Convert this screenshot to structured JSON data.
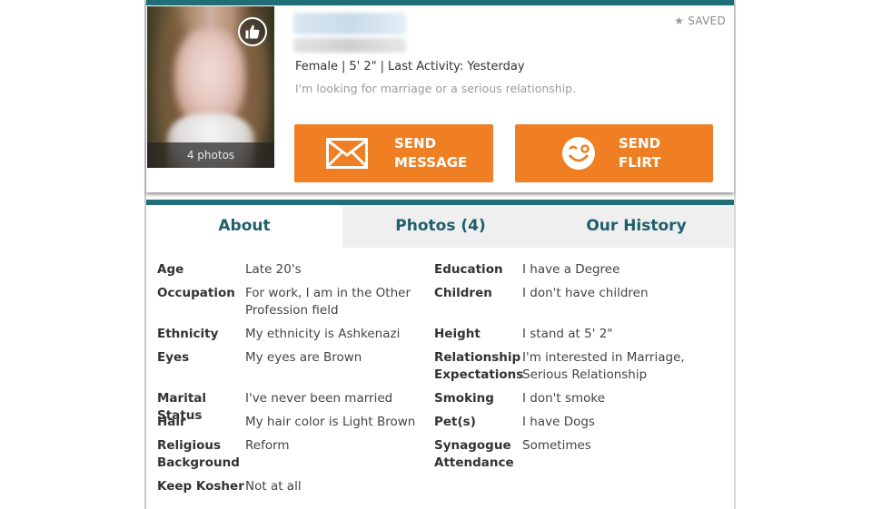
{
  "profile": {
    "saved_label": "SAVED",
    "summary": {
      "gender": "Female",
      "height": "5' 2\"",
      "last_activity": "Last Activity: Yesterday"
    },
    "looking_for": "I'm looking for marriage or a serious relationship.",
    "photo_count": "4 photos",
    "icons": {
      "like": "thumbs-up-icon",
      "saved": "star-icon",
      "message": "envelope-icon",
      "flirt": "wink-face-icon"
    }
  },
  "actions": {
    "message": {
      "line1": "SEND",
      "line2": "MESSAGE"
    },
    "flirt": {
      "line1": "SEND",
      "line2": "FLIRT"
    },
    "color": "#ef7f22"
  },
  "tabs": [
    {
      "label": "About",
      "active": true
    },
    {
      "label": "Photos (4)",
      "active": false
    },
    {
      "label": "Our History",
      "active": false
    }
  ],
  "accent_color": "#1f6e78",
  "details_left": [
    {
      "key": "Age",
      "value": "Late 20's"
    },
    {
      "key": "Occupation",
      "value": "For work, I am in the Other Profession field"
    },
    {
      "key": "Ethnicity",
      "value": "My ethnicity is Ashkenazi"
    },
    {
      "key": "Eyes",
      "value": "My eyes are Brown"
    },
    {
      "key": "Marital Status",
      "value": "I've never been married"
    },
    {
      "key": "Hair",
      "value": "My hair color is Light Brown"
    },
    {
      "key": "Religious Background",
      "value": "Reform"
    },
    {
      "key": "Keep Kosher",
      "value": "Not at all"
    }
  ],
  "details_right": [
    {
      "key": "Education",
      "value": "I have a Degree"
    },
    {
      "key": "Children",
      "value": "I don't have children"
    },
    {
      "key": "Height",
      "value": "I stand at 5' 2\""
    },
    {
      "key": "Relationship Expectations",
      "value": "I'm interested in Marriage, Serious Relationship"
    },
    {
      "key": "Smoking",
      "value": "I don't smoke"
    },
    {
      "key": "Pet(s)",
      "value": "I have Dogs"
    },
    {
      "key": "Synagogue Attendance",
      "value": "Sometimes"
    }
  ]
}
